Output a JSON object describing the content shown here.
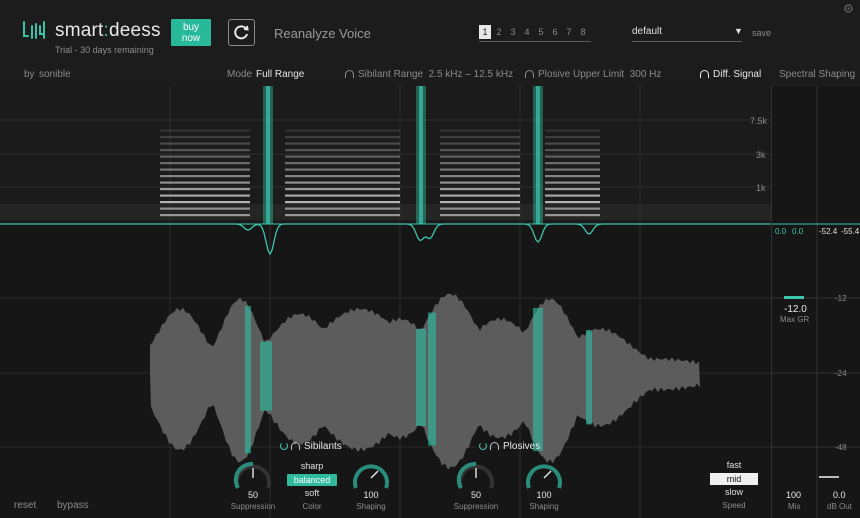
{
  "app": {
    "brand_part1": "smart",
    "brand_sep": ":",
    "brand_part2": "deess",
    "trial": "Trial - 30 days remaining",
    "buy_line1": "buy",
    "buy_line2": "now",
    "reanalyze": "Reanalyze Voice"
  },
  "presets": {
    "slots": [
      "1",
      "2",
      "3",
      "4",
      "5",
      "6",
      "7",
      "8"
    ],
    "active_slot": "1",
    "name": "default",
    "save": "save"
  },
  "modebar": {
    "by": "by",
    "company": "sonible",
    "mode_label": "Mode",
    "mode_value": "Full Range",
    "sibilant_label": "Sibilant Range",
    "sibilant_value": "2.5 kHz – 12.5 kHz",
    "plosive_label": "Plosive Upper Limit",
    "plosive_value": "300 Hz",
    "diff_signal": "Diff. Signal",
    "spectral_shaping": "Spectral Shaping"
  },
  "spectrogram": {
    "freq_labels": [
      "7.5k",
      "3k",
      "1k"
    ]
  },
  "waveform": {
    "db_labels": [
      "-12",
      "-24",
      "-48"
    ]
  },
  "meters": {
    "left_vals": [
      "0.0",
      "0.0"
    ],
    "right_vals": [
      "-52.4",
      "-55.4"
    ],
    "max_gr_value": "-12.0",
    "max_gr_label": "Max GR",
    "mix_value": "100",
    "mix_label": "Mix",
    "out_value": "0.0",
    "out_label": "dB Out"
  },
  "sibilants": {
    "title": "Sibilants",
    "suppression_value": "50",
    "suppression_label": "Suppression",
    "color_options": [
      "sharp",
      "balanced",
      "soft"
    ],
    "color_selected": "balanced",
    "color_label": "Color",
    "shaping_value": "100",
    "shaping_label": "Shaping"
  },
  "plosives": {
    "title": "Plosives",
    "suppression_value": "50",
    "suppression_label": "Suppression",
    "shaping_value": "100",
    "shaping_label": "Shaping"
  },
  "speed": {
    "options": [
      "fast",
      "mid",
      "slow"
    ],
    "selected": "mid",
    "label": "Speed"
  },
  "footer": {
    "reset": "reset",
    "bypass": "bypass"
  },
  "colors": {
    "accent": "#2fb99d",
    "background": "#161616"
  }
}
